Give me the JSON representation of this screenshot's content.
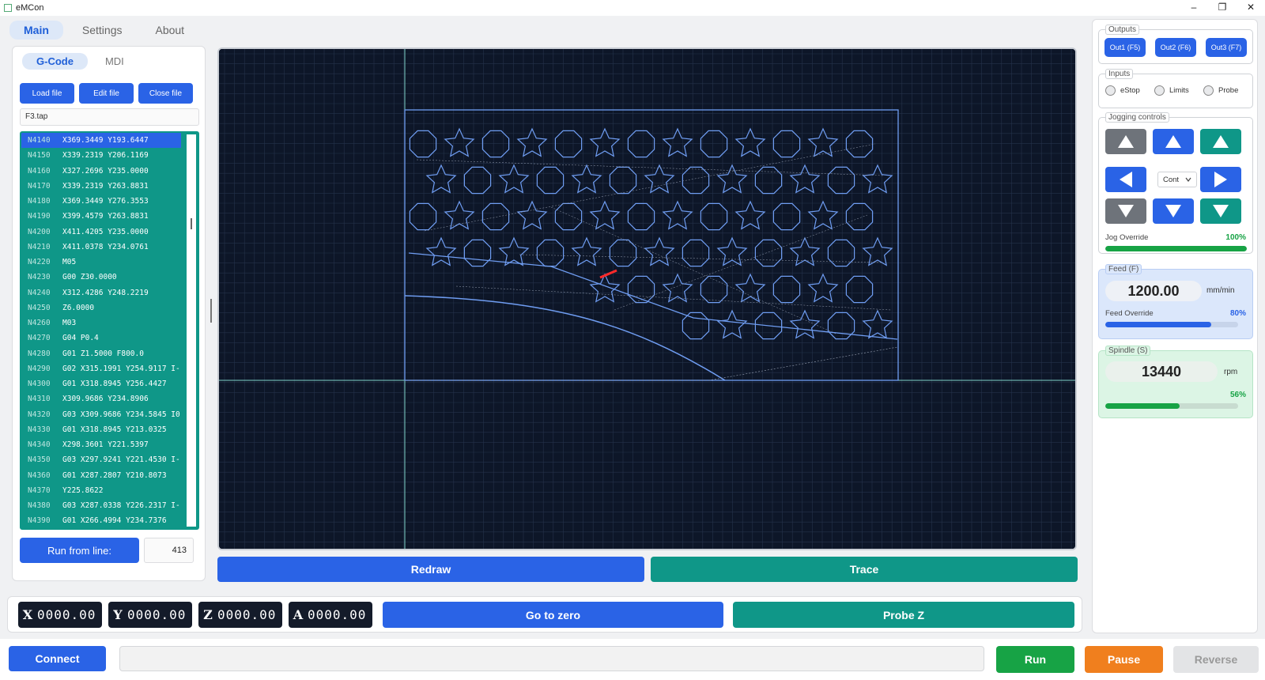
{
  "window": {
    "title": "eMCon",
    "minimize": "–",
    "maximize": "❐",
    "close": "✕"
  },
  "tabs": [
    {
      "label": "Main"
    },
    {
      "label": "Settings"
    },
    {
      "label": "About"
    }
  ],
  "left": {
    "subtabs": [
      {
        "label": "G-Code"
      },
      {
        "label": "MDI"
      }
    ],
    "buttons": {
      "load": "Load file",
      "edit": "Edit file",
      "close": "Close file"
    },
    "file_name": "F3.tap",
    "selected_index": 0,
    "gcode": [
      {
        "n": "N4140",
        "code": "X369.3449 Y193.6447"
      },
      {
        "n": "N4150",
        "code": "X339.2319 Y206.1169"
      },
      {
        "n": "N4160",
        "code": "X327.2696 Y235.0000"
      },
      {
        "n": "N4170",
        "code": "X339.2319 Y263.8831"
      },
      {
        "n": "N4180",
        "code": "X369.3449 Y276.3553"
      },
      {
        "n": "N4190",
        "code": "X399.4579 Y263.8831"
      },
      {
        "n": "N4200",
        "code": "X411.4205 Y235.0000"
      },
      {
        "n": "N4210",
        "code": "X411.0378 Y234.0761"
      },
      {
        "n": "N4220",
        "code": "M05"
      },
      {
        "n": "N4230",
        "code": "G00 Z30.0000"
      },
      {
        "n": "N4240",
        "code": "X312.4286 Y248.2219"
      },
      {
        "n": "N4250",
        "code": "Z6.0000"
      },
      {
        "n": "N4260",
        "code": "M03"
      },
      {
        "n": "N4270",
        "code": "G04 P0.4"
      },
      {
        "n": "N4280",
        "code": "G01 Z1.5000 F800.0"
      },
      {
        "n": "N4290",
        "code": "G02 X315.1991 Y254.9117 I-"
      },
      {
        "n": "N4300",
        "code": "G01 X318.8945 Y256.4427"
      },
      {
        "n": "N4310",
        "code": "X309.9686 Y234.8906"
      },
      {
        "n": "N4320",
        "code": "G03 X309.9686 Y234.5845 I0"
      },
      {
        "n": "N4330",
        "code": "G01 X318.8945 Y213.0325"
      },
      {
        "n": "N4340",
        "code": "X298.3601 Y221.5397"
      },
      {
        "n": "N4350",
        "code": "G03 X297.9241 Y221.4530 I-"
      },
      {
        "n": "N4360",
        "code": "G01 X287.2807 Y210.8073"
      },
      {
        "n": "N4370",
        "code": "Y225.8622"
      },
      {
        "n": "N4380",
        "code": "G03 X287.0338 Y226.2317 I-"
      },
      {
        "n": "N4390",
        "code": "G01 X266.4994 Y234.7376"
      }
    ],
    "run_from_label": "Run from line:",
    "run_from_value": "413"
  },
  "canvas": {
    "bg": "#0d1628",
    "grid": "#25324a",
    "axis": "#7fd3c8",
    "path": "#6f9df2",
    "rapid": "#9aa3b5",
    "tool": "#ff2a2a",
    "redraw": "Redraw",
    "trace": "Trace"
  },
  "coords": [
    {
      "axis": "X",
      "value": "0000.00"
    },
    {
      "axis": "Y",
      "value": "0000.00"
    },
    {
      "axis": "Z",
      "value": "0000.00"
    },
    {
      "axis": "A",
      "value": "0000.00"
    }
  ],
  "go_zero": "Go to zero",
  "probe_z": "Probe Z",
  "bottom": {
    "connect": "Connect",
    "status": "",
    "run": "Run",
    "pause": "Pause",
    "reverse": "Reverse"
  },
  "right": {
    "outputs": {
      "title": "Outputs",
      "out1": "Out1 (F5)",
      "out2": "Out2 (F6)",
      "out3": "Out3 (F7)"
    },
    "inputs": {
      "title": "Inputs",
      "estop": "eStop",
      "limits": "Limits",
      "probe": "Probe"
    },
    "jog": {
      "title": "Jogging controls",
      "mode": "Cont",
      "override_label": "Jog Override",
      "override_value": "100%",
      "override_level": 1.0
    },
    "feed": {
      "title": "Feed (F)",
      "value": "1200.00",
      "unit": "mm/min",
      "override_label": "Feed Override",
      "override_value": "80%",
      "override_level": 0.8
    },
    "spindle": {
      "title": "Spindle (S)",
      "value": "13440",
      "unit": "rpm",
      "override_value": "56%",
      "override_level": 0.56
    }
  },
  "icons": {
    "up": "triangle-up-icon",
    "down": "triangle-down-icon",
    "left": "triangle-left-icon",
    "right": "triangle-right-icon"
  }
}
